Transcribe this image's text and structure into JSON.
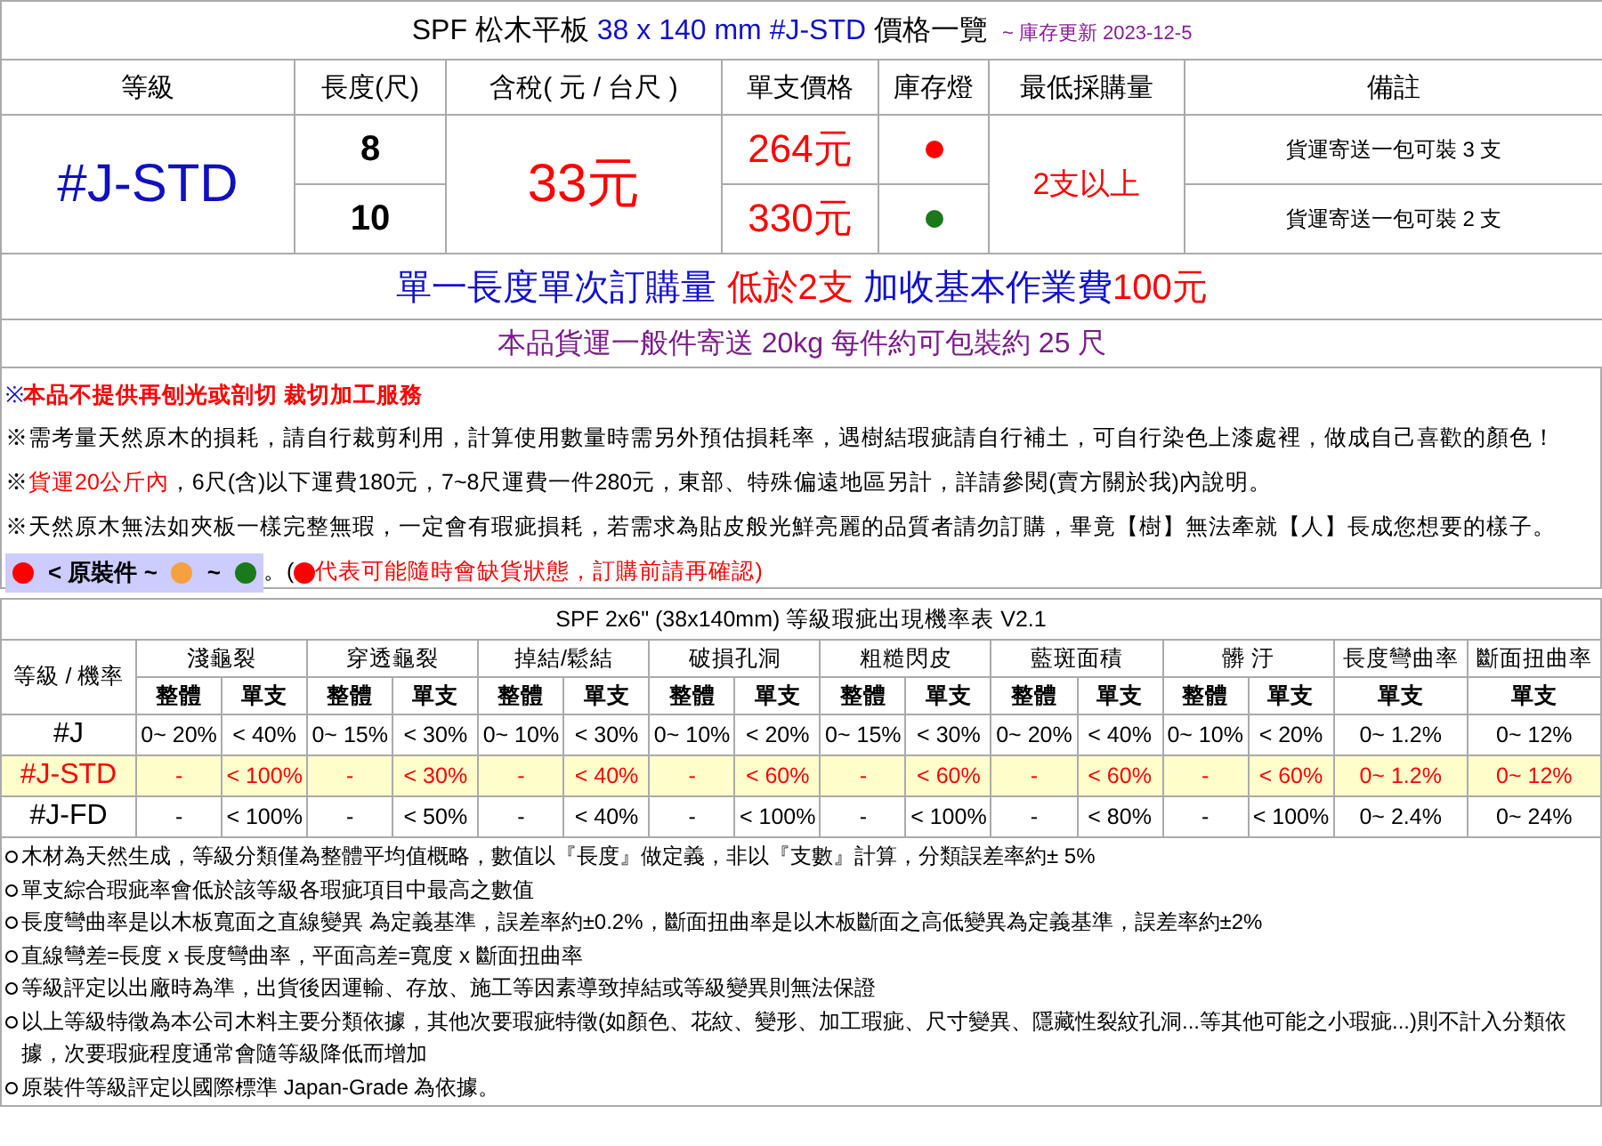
{
  "header": {
    "title": [
      {
        "kind": "plain",
        "text": "SPF 松木平板 "
      },
      {
        "kind": "blue",
        "text": "38 x 140 mm"
      },
      {
        "kind": "blue",
        "text": " #J-STD"
      },
      {
        "kind": "plain",
        "text": " 價格一覽"
      }
    ],
    "update_note": "~ 庫存更新 2023-12-5"
  },
  "price_table": {
    "columns": [
      "等級",
      "長度(尺)",
      "含稅( 元 / 台尺 )",
      "單支價格",
      "庫存燈",
      "最低採購量",
      "備註"
    ],
    "grade": "#J-STD",
    "unit_price": "33元",
    "min_order": "2支以上",
    "rows": [
      {
        "length": "8",
        "price": "264元",
        "color": "#ff0000",
        "note": "貨運寄送一包可裝 3 支"
      },
      {
        "length": "10",
        "price": "330元",
        "color": "#1a7a1a",
        "note": "貨運寄送一包可裝 2 支"
      }
    ],
    "surcharge": [
      {
        "kind": "blue",
        "text": "單一長度單次訂購量 "
      },
      {
        "kind": "red",
        "text": " 低於2支 "
      },
      {
        "kind": "blue",
        "text": " 加收基本作業費"
      },
      {
        "kind": "red",
        "text": "100元"
      }
    ],
    "shipping_note": "本品貨運一般件寄送 20kg 每件約可包裝約 25 尺"
  },
  "notices": [
    [
      {
        "kind": "blue",
        "text": "※"
      },
      {
        "kind": "redbold",
        "text": "本品不提供再刨光或剖切 裁切加工服務"
      }
    ],
    [
      {
        "kind": "plain",
        "text": "※需考量天然原木的損耗，請自行裁剪利用，計算使用數量時需另外預估損耗率，遇樹結瑕疵請自行補土，可自行染色上漆處裡，做成自己喜歡的顏色！"
      }
    ],
    [
      {
        "kind": "plain",
        "text": "※"
      },
      {
        "kind": "red",
        "text": "貨運20公斤內"
      },
      {
        "kind": "plain",
        "text": "，6尺(含)以下運費180元，7~8尺運費一件280元，東部、特殊偏遠地區另計，詳請參閱(賣方關於我)內說明。"
      }
    ],
    [
      {
        "kind": "plain",
        "text": "※天然原木無法如夾板一樣完整無瑕，一定會有瑕疵損耗，若需求為貼皮般光鮮亮麗的品質者請勿訂購，畢竟【樹】無法牽就【人】長成您想要的樣子。"
      }
    ]
  ],
  "legend": {
    "items": [
      {
        "kind": "dot",
        "color": "#ff0000"
      },
      {
        "kind": "text",
        "text": "< 原裝件  ~"
      },
      {
        "kind": "dot",
        "color": "#f7a040"
      },
      {
        "kind": "text",
        "text": "~"
      },
      {
        "kind": "dot",
        "color": "#1a7a1a"
      }
    ],
    "lead": "。(",
    "warning_dot": {
      "color": "#ff0000"
    },
    "warning": "代表可能隨時會缺貨狀態，訂購前請再確認)"
  },
  "defect_table": {
    "title": "SPF 2x6\" (38x140mm) 等級瑕疵出現機率表 V2.1",
    "corner": "等級 / 機率",
    "groups": [
      {
        "name": "淺龜裂",
        "subs": [
          "整體",
          "單支"
        ]
      },
      {
        "name": "穿透龜裂",
        "subs": [
          "整體",
          "單支"
        ]
      },
      {
        "name": "掉結/鬆結",
        "subs": [
          "整體",
          "單支"
        ]
      },
      {
        "name": "破損孔洞",
        "subs": [
          "整體",
          "單支"
        ]
      },
      {
        "name": "粗糙閃皮",
        "subs": [
          "整體",
          "單支"
        ]
      },
      {
        "name": "藍斑面積",
        "subs": [
          "整體",
          "單支"
        ]
      },
      {
        "name": "髒 汙",
        "subs": [
          "整體",
          "單支"
        ]
      },
      {
        "name": "長度彎曲率",
        "subs": [
          "單支"
        ]
      },
      {
        "name": "斷面扭曲率",
        "subs": [
          "單支"
        ]
      }
    ],
    "rows": [
      {
        "grade": "#J",
        "highlighted": false,
        "cells": [
          "0~ 20%",
          "< 40%",
          "0~ 15%",
          "< 30%",
          "0~ 10%",
          "< 30%",
          "0~ 10%",
          "< 20%",
          "0~ 15%",
          "< 30%",
          "0~ 20%",
          "< 40%",
          "0~ 10%",
          "< 20%",
          "0~ 1.2%",
          "0~ 12%"
        ]
      },
      {
        "grade": "#J-STD",
        "highlighted": true,
        "cells": [
          "-",
          "< 100%",
          "-",
          "< 30%",
          "-",
          "< 40%",
          "-",
          "< 60%",
          "-",
          "< 60%",
          "-",
          "< 60%",
          "-",
          "< 60%",
          "0~ 1.2%",
          "0~ 12%"
        ]
      },
      {
        "grade": "#J-FD",
        "highlighted": false,
        "cells": [
          "-",
          "< 100%",
          "-",
          "< 50%",
          "-",
          "< 40%",
          "-",
          "< 100%",
          "-",
          "< 100%",
          "-",
          "< 80%",
          "-",
          "< 100%",
          "0~ 2.4%",
          "0~ 24%"
        ]
      }
    ]
  },
  "remarks": [
    "木材為天然生成，等級分類僅為整體平均值概略，數值以『長度』做定義，非以『支數』計算，分類誤差率約± 5%",
    "單支綜合瑕疵率會低於該等級各瑕疵項目中最高之數值",
    "長度彎曲率是以木板寬面之直線變異 為定義基準，誤差率約±0.2%，斷面扭曲率是以木板斷面之高低變異為定義基準，誤差率約±2%",
    "直線彎差=長度 x 長度彎曲率，平面高差=寬度 x 斷面扭曲率",
    "等級評定以出廠時為準，出貨後因運輸、存放、施工等因素導致掉結或等級變異則無法保證",
    "以上等級特徵為本公司木料主要分類依據，其他次要瑕疵特徵(如顏色、花紋、變形、加工瑕疵、尺寸變異、隱藏性裂紋孔洞...等其他可能之小瑕疵...)則不計入分類依據，次要瑕疵程度通常會隨等級降低而增加",
    "原裝件等級評定以國際標準 Japan-Grade 為依據。"
  ]
}
